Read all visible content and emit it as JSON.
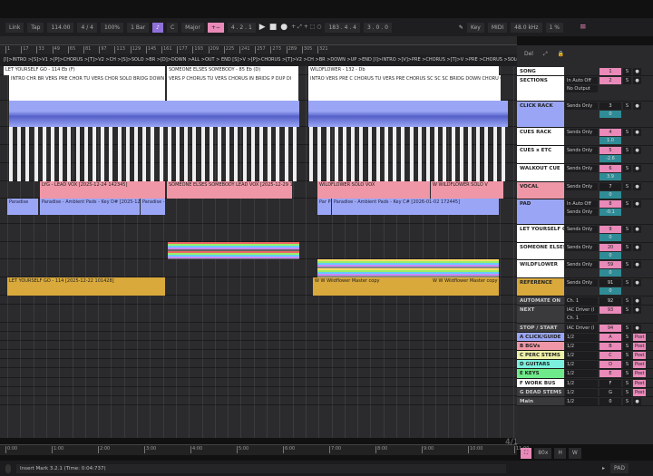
{
  "toolbar": {
    "link": "Link",
    "tap": "Tap",
    "tempo": "114.00",
    "signature": "4 / 4",
    "zoom": "100%",
    "quantize": "1 Bar",
    "key_root": "C",
    "key_scale": "Major",
    "position": "4 . 2 . 1",
    "loop_start": "183 . 4 . 4",
    "loop_length": "3 . 0 . 0",
    "key": "Key",
    "midi": "MIDI",
    "sample_rate": "48.0 kHz",
    "cpu": "1 %"
  },
  "ruler": [
    "1",
    "17",
    "33",
    "49",
    "65",
    "81",
    "97",
    "113",
    "129",
    "145",
    "161",
    "177",
    "193",
    "209",
    "225",
    "241",
    "257",
    "273",
    "289",
    "305",
    "321"
  ],
  "locators": "[I]>INTRO >[S]>V1 >[P]>CHORUS >[T]>V2 >CH >[S]>SOLO >BR >[D]>DOWN >ALL >OUT > END   [S]>V >[P]>CHORUS >[T]>V2 >CH >BR >DOWN >UP >END   [I]>INTRO >[V]>PRE >CHORUS >[T]>V >PRE >CHORUS >SOLO >BRIDGE >DOWN >CHORUS >OUT >END",
  "song_clips": [
    "LET YOURSELF GO - 114 Eb (F)",
    "SOMEONE ELSES SOMEBODY - 85 Eb (D)",
    "WILDFLOWER - 132 - Db"
  ],
  "section_clips": [
    "INTRO CHR BR VERS PRE CHOR TU VERS CHOR SOLO BRIDG DOWN ALL OUTR",
    "VERS P CHORUS TU VERS CHORUS IN BRIDG P DUP DI",
    "INTRO VERS PRE C CHORUS TU VERS PRE CHORUS SC SC SC BRIDG DOWN CHORU OUTRE"
  ],
  "vocal_clips": [
    "LYG - LEAD VOX [2025-12-24 142345]",
    "SOMEONE ELSES SOMEBODY LEAD VOX [2025-12-29 1",
    "WILDFLOWER SOLO VOX",
    "W WILDFLOWER SOLO V"
  ],
  "pad_clips": [
    "Paradise",
    "Paradise - Ambient Pads - Key D# [2025-12-29 1",
    "Paradise - A",
    "Par P",
    "Paradise - Ambient Pads - Key C# [2026-01-02 172445]"
  ],
  "reference_clips": [
    "LET YOURSELF GO - 114 [2025-12-22 101428]",
    "W W Wildflower Master copy",
    "W W Wildflower Master copy"
  ],
  "panel": {
    "del": "Del"
  },
  "tracks": [
    {
      "name": "SONG",
      "color": "#ffffff",
      "io": [],
      "num": "1",
      "pink": true
    },
    {
      "name": "SECTIONS",
      "color": "#ffffff",
      "io": [
        "In Auto Off",
        "No Output"
      ],
      "num": "2",
      "pink": true
    },
    {
      "name": "CLICK RACK",
      "color": "#9aa6f5",
      "io": [
        "Sends Only"
      ],
      "num": "3",
      "vol": "0"
    },
    {
      "name": "CUES RACK",
      "color": "#ffffff",
      "io": [
        "Sends Only"
      ],
      "num": "4",
      "pink": true,
      "vol": "1.0"
    },
    {
      "name": "CUES x ETC",
      "color": "#ffffff",
      "io": [
        "Sends Only"
      ],
      "num": "5",
      "pink": true,
      "vol": "-2.6"
    },
    {
      "name": "WALKOUT CUE",
      "color": "#ffffff",
      "io": [
        "Sends Only"
      ],
      "num": "6",
      "pink": true,
      "vol": "3.9"
    },
    {
      "name": "VOCAL",
      "color": "#ef97a6",
      "io": [
        "Sends Only"
      ],
      "num": "7",
      "vol": "0"
    },
    {
      "name": "PAD",
      "color": "#9aa6f5",
      "io": [
        "In Auto Off",
        "Sends Only"
      ],
      "num": "8",
      "pink": true,
      "vol": "-0.1"
    },
    {
      "name": "LET YOURSELF G",
      "color": "#ffffff",
      "io": [
        "Sends Only"
      ],
      "num": "9",
      "pink": true,
      "vol": "0"
    },
    {
      "name": "SOMEONE ELSES",
      "color": "#ffffff",
      "io": [
        "Sends Only"
      ],
      "num": "20",
      "pink": true,
      "vol": "0"
    },
    {
      "name": "WILDFLOWER",
      "color": "#ffffff",
      "io": [
        "Sends Only"
      ],
      "num": "59",
      "pink": true,
      "vol": "0"
    },
    {
      "name": "REFERENCE",
      "color": "#d9a93c",
      "io": [
        "Sends Only"
      ],
      "num": "91",
      "vol": "0"
    },
    {
      "name": "AUTOMATE ON",
      "color": "#3a3a3d",
      "io": [
        "Ch. 1"
      ],
      "num": "92"
    },
    {
      "name": "NEXT",
      "color": "#3a3a3d",
      "io": [
        "IAC Driver (I",
        "Ch. 1"
      ],
      "num": "93",
      "pink": true
    },
    {
      "name": "STOP / START",
      "color": "#3a3a3d",
      "io": [
        "IAC Driver (I"
      ],
      "num": "94",
      "pink": true
    },
    {
      "name": "A CLICK/GUIDE",
      "color": "#9aa6f5",
      "io": [
        "1/2"
      ],
      "num": "A",
      "pink": true,
      "post": "Post"
    },
    {
      "name": "B BGVs",
      "color": "#ef97a6",
      "io": [
        "1/2"
      ],
      "num": "B",
      "pink": true,
      "post": "Post"
    },
    {
      "name": "C PERC STEMS",
      "color": "#eef0a8",
      "io": [
        "1/2"
      ],
      "num": "C",
      "pink": true,
      "post": "Post"
    },
    {
      "name": "D GUITARS",
      "color": "#7cf0de",
      "io": [
        "1/2"
      ],
      "num": "D",
      "pink": true,
      "post": "Post"
    },
    {
      "name": "E KEYS",
      "color": "#6fea8a",
      "io": [
        "1/2"
      ],
      "num": "E",
      "pink": true,
      "post": "Post"
    },
    {
      "name": "F WORK BUS",
      "color": "#ffffff",
      "io": [
        "1/2"
      ],
      "num": "F",
      "post": "Post"
    },
    {
      "name": "G DEAD STEMS",
      "color": "#3a3a3d",
      "io": [
        "1/2"
      ],
      "num": "G",
      "post": "Post"
    },
    {
      "name": "Main",
      "color": "#3a3a3d",
      "io": [
        "1/2"
      ],
      "num": "0"
    }
  ],
  "timeline": [
    "0:00",
    "1:00",
    "2:00",
    "3:00",
    "4:00",
    "5:00",
    "6:00",
    "7:00",
    "8:00",
    "9:00",
    "10:00",
    "11:00"
  ],
  "time_signature_display": "4/1",
  "zoom_readout": "80x",
  "status": {
    "text": "Insert Mark 3.2.1 (Time: 0:04:737)",
    "track_label": "PAD"
  }
}
